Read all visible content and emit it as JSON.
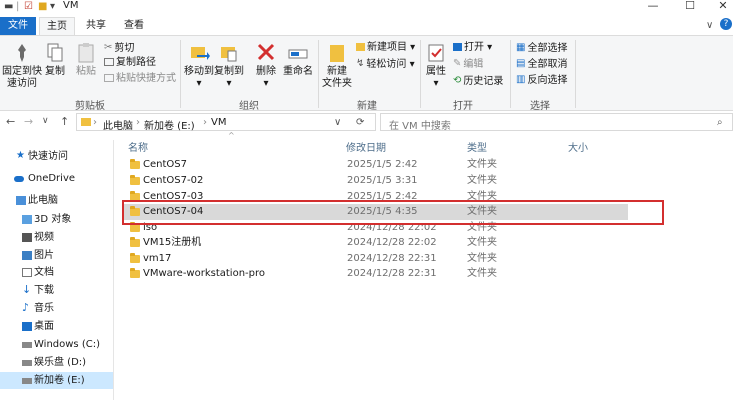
{
  "titlebar": {
    "title": "VM",
    "minimize_glyph": "—",
    "maximize_glyph": "☐",
    "close_glyph": "✕"
  },
  "tabs": [
    {
      "label": "文件"
    },
    {
      "label": "主页"
    },
    {
      "label": "共享"
    },
    {
      "label": "查看"
    }
  ],
  "ribbon": {
    "clipboard": {
      "pin": "固定到快速访问",
      "pin_line1": "固定到快",
      "pin_line2": "速访问",
      "copy": "复制",
      "paste": "粘贴",
      "cut": "剪切",
      "copy_path": "复制路径",
      "paste_shortcut": "粘贴快捷方式",
      "label": "剪贴板"
    },
    "organize": {
      "move_to": "移动到",
      "copy_to": "复制到",
      "delete": "删除",
      "rename": "重命名",
      "label": "组织"
    },
    "new": {
      "new_folder_line1": "新建",
      "new_folder_line2": "文件夹",
      "new_item": "新建项目",
      "easy_access": "轻松访问",
      "label": "新建"
    },
    "open": {
      "properties": "属性",
      "open": "打开",
      "edit": "编辑",
      "history": "历史记录",
      "label": "打开"
    },
    "select": {
      "select_all": "全部选择",
      "select_none": "全部取消",
      "invert": "反向选择",
      "label": "选择"
    }
  },
  "address": {
    "crumbs": [
      "此电脑",
      "新加卷 (E:)",
      "VM"
    ],
    "search_placeholder": "在 VM 中搜索"
  },
  "nav": [
    {
      "label": "快速访问",
      "icon": "star-icon"
    },
    {
      "label": "OneDrive",
      "icon": "cloud-icon"
    },
    {
      "label": "此电脑",
      "icon": "computer-icon"
    },
    {
      "label": "3D 对象",
      "icon": "cube-icon"
    },
    {
      "label": "视频",
      "icon": "video-icon"
    },
    {
      "label": "图片",
      "icon": "picture-icon"
    },
    {
      "label": "文档",
      "icon": "document-icon"
    },
    {
      "label": "下载",
      "icon": "download-icon"
    },
    {
      "label": "音乐",
      "icon": "music-icon"
    },
    {
      "label": "桌面",
      "icon": "desktop-icon"
    },
    {
      "label": "Windows (C:)",
      "icon": "drive-icon"
    },
    {
      "label": "娱乐盘 (D:)",
      "icon": "drive-icon"
    },
    {
      "label": "新加卷 (E:)",
      "icon": "drive-icon"
    }
  ],
  "columns": {
    "name": "名称",
    "date": "修改日期",
    "type": "类型",
    "size": "大小"
  },
  "files": [
    {
      "name": "CentOS7",
      "date": "2025/1/5 2:42",
      "type": "文件夹"
    },
    {
      "name": "CentOS7-02",
      "date": "2025/1/5 3:31",
      "type": "文件夹"
    },
    {
      "name": "CentOS7-03",
      "date": "2025/1/5 2:42",
      "type": "文件夹"
    },
    {
      "name": "CentOS7-04",
      "date": "2025/1/5 4:35",
      "type": "文件夹"
    },
    {
      "name": "iso",
      "date": "2024/12/28 22:02",
      "type": "文件夹"
    },
    {
      "name": "VM15注册机",
      "date": "2024/12/28 22:02",
      "type": "文件夹"
    },
    {
      "name": "vm17",
      "date": "2024/12/28 22:31",
      "type": "文件夹"
    },
    {
      "name": "VMware-workstation-pro",
      "date": "2024/12/28 22:31",
      "type": "文件夹"
    }
  ],
  "colors": {
    "accent": "#1a6fc9",
    "highlight_border": "#d32f2f",
    "selection": "#cce8ff"
  }
}
